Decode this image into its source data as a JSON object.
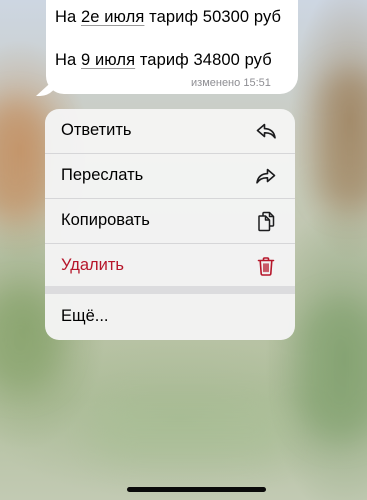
{
  "message": {
    "line1": {
      "prefix": "На ",
      "underlined": "2е июля",
      "suffix": " тариф 50300 руб"
    },
    "line2": {
      "prefix": "На ",
      "underlined": "9 июля",
      "suffix": " тариф 34800 руб"
    },
    "edited_label": "изменено",
    "time": "15:51"
  },
  "context_menu": {
    "items": [
      {
        "label": "Ответить",
        "icon": "reply-icon"
      },
      {
        "label": "Переслать",
        "icon": "forward-icon"
      },
      {
        "label": "Копировать",
        "icon": "copy-icon"
      },
      {
        "label": "Удалить",
        "icon": "trash-icon"
      }
    ],
    "more_label": "Ещё..."
  },
  "colors": {
    "destructive": "#b6162a",
    "bubble": "#ffffff",
    "menu_background": "#f4f4f4"
  }
}
